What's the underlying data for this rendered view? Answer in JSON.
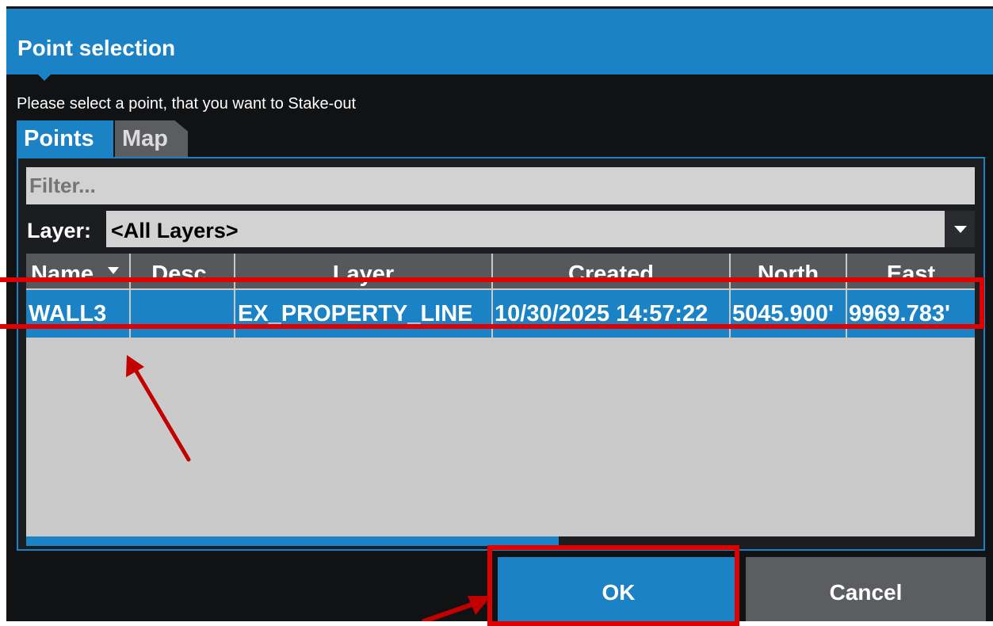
{
  "dialog": {
    "title": "Point selection",
    "instruction": "Please select a point, that you want to Stake-out"
  },
  "tabs": [
    {
      "label": "Points",
      "active": true
    },
    {
      "label": "Map",
      "active": false
    }
  ],
  "filter": {
    "placeholder": "Filter..."
  },
  "layer_filter": {
    "label": "Layer:",
    "value": "<All Layers>"
  },
  "table": {
    "columns": [
      "Name",
      "Desc.",
      "Layer",
      "Created",
      "North",
      "East"
    ],
    "sort_column": "Name",
    "rows": [
      {
        "name": "WALL3",
        "desc": "",
        "layer": "EX_PROPERTY_LINE",
        "created": "10/30/2025 14:57:22",
        "north": "5045.900'",
        "east": "9969.783'",
        "selected": true
      }
    ]
  },
  "buttons": {
    "ok": "OK",
    "cancel": "Cancel"
  },
  "colors": {
    "accent": "#1b82c5",
    "background": "#111214",
    "annotation": "#e00000"
  }
}
